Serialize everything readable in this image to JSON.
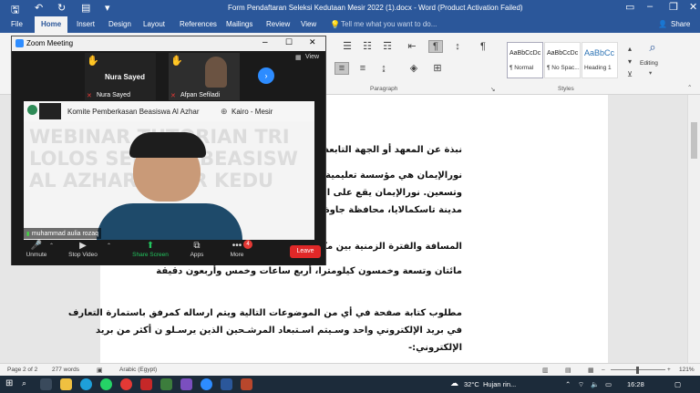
{
  "word": {
    "title": "Form Pendaftaran Seleksi Kedutaan Mesir 2022 (1).docx  -  Word (Product Activation Failed)",
    "tabs": [
      "File",
      "Home",
      "Insert",
      "Design",
      "Layout",
      "References",
      "Mailings",
      "Review",
      "View"
    ],
    "tell_me": "Tell me what you want to do...",
    "share": "Share",
    "styles": [
      {
        "sample": "AaBbCcDc",
        "name": "¶ Normal"
      },
      {
        "sample": "AaBbCcDc",
        "name": "¶ No Spac..."
      },
      {
        "sample": "AaBbCc",
        "name": "Heading 1"
      }
    ],
    "groups": {
      "paragraph": "Paragraph",
      "styles": "Styles",
      "editing": "Editing"
    },
    "accent": "#2b579a"
  },
  "document": {
    "paragraphs": [
      "نبذة عن المعهد أو الجهة التابعة لها المترشح/المترشحة",
      "نورالإيمان هي مؤسسة تعليمية إسلامية التي تأسست",
      "وتسعين. نورالإيمان يقع على الشارع فراكن فانجاح",
      "مدينة تاسكمالايا، محافظة جاوة الغربية.",
      "المسافة والفترة الزمنية بين مكان الإقامة ومقر السفارة",
      "مائتان وتسعة وخمسون كيلومترا، أربع ساعات وخمس وأربعون دقيقة",
      "مطلوب كتابة صفحة في أي من الموضوعات التالية ويتم ارساله كمرفق باستمارة التعارف",
      "في بريد الإلكتروني واحد وسـيتم اسـتبعاد المرشـحين الذين يرسـلو ن أكثر من بريد",
      "الإلكتروني:-"
    ]
  },
  "statusbar": {
    "page": "Page 2 of 2",
    "words": "277 words",
    "language": "Arabic (Egypt)",
    "zoom": "121%"
  },
  "zoom_app": {
    "title": "Zoom Meeting",
    "view_label": "View",
    "participants": [
      {
        "name": "Nura Sayed",
        "label": "Nura Sayed"
      },
      {
        "name": "Afpan Sefiladi",
        "label": "Afpan Sefiladi"
      }
    ],
    "speaker_name": "muhammad aulia rozaq",
    "banner_text": "Komite Pemberkasan Beasiswa Al Azhar",
    "banner_location": "Kairo - Mesir",
    "watermark_lines": [
      "WEBINAR TUTORIAN TRI",
      "LOLOS SELEKSI BEASISW",
      "AL AZHAR JALUR KEDU"
    ],
    "controls": {
      "mute": "Unmute",
      "video": "Stop Video",
      "share": "Share Screen",
      "apps": "Apps",
      "more": "More",
      "more_badge": "4",
      "leave": "Leave"
    },
    "colors": {
      "leave": "#e02828",
      "share": "#22c55e",
      "next": "#2d8cff"
    }
  },
  "taskbar": {
    "weather_temp": "32°C",
    "weather_text": "Hujan rin...",
    "time": "16:28"
  }
}
